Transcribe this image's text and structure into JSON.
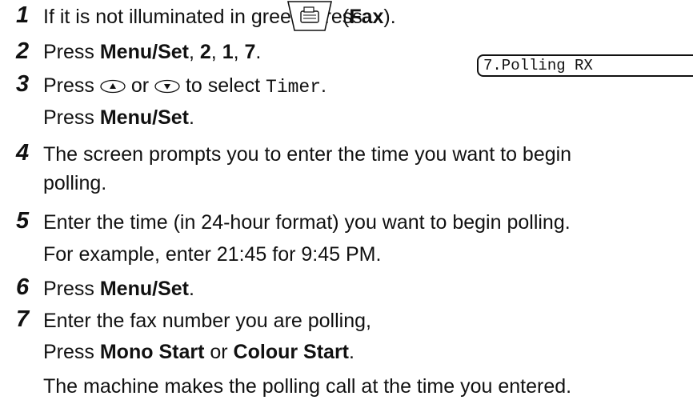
{
  "steps": [
    {
      "num": "1",
      "pre": "If it is not illuminated in green, press",
      "key": "Fax"
    },
    {
      "num": "2",
      "pre": "Press",
      "menu": "Menu/Set",
      "sep1": ",",
      "d1": "2",
      "sep2": ",",
      "d2": "1",
      "sep3": ",",
      "d3": "7",
      "end": "."
    },
    {
      "num": "3",
      "pre": "Press",
      "or": "or",
      "mid": "to select",
      "option": "Timer",
      "end": ".",
      "line2_pre": "Press",
      "line2_menu": "Menu/Set",
      "line2_end": "."
    },
    {
      "num": "4",
      "text1": "The screen prompts you to enter the time you want to begin",
      "text2": "polling."
    },
    {
      "num": "5",
      "text1": "Enter the time (in 24-hour format) you want to begin polling.",
      "text2": "For example, enter 21:45 for 9:45 PM."
    },
    {
      "num": "6",
      "pre": "Press",
      "menu": "Menu/Set",
      "end": "."
    },
    {
      "num": "7",
      "text1": "Enter the fax number you are polling,",
      "line2_pre": "Press",
      "mono": "Mono Start",
      "or": "or",
      "colour": "Colour Start",
      "end": ".",
      "text3": "The machine makes the polling call at the time you entered."
    }
  ],
  "lcd_display": "7.Polling RX",
  "icons": {
    "fax_key": "fax-machine-icon",
    "up": "up-arrow-key-icon",
    "down": "down-arrow-key-icon"
  }
}
